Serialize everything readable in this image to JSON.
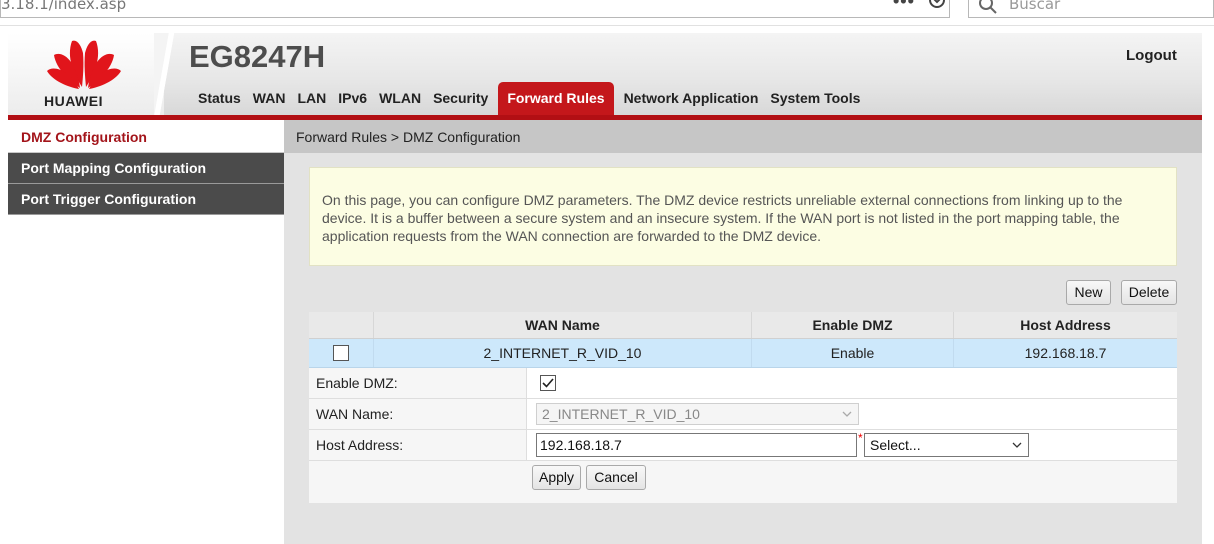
{
  "browser": {
    "url": "3.18.1/index.asp",
    "search_placeholder": "Buscar"
  },
  "header": {
    "brand": "HUAWEI",
    "model": "EG8247H",
    "logout": "Logout",
    "brand_color": "#c4171b"
  },
  "nav": {
    "tabs": [
      {
        "label": "Status"
      },
      {
        "label": "WAN"
      },
      {
        "label": "LAN"
      },
      {
        "label": "IPv6"
      },
      {
        "label": "WLAN"
      },
      {
        "label": "Security"
      },
      {
        "label": "Forward Rules",
        "active": true
      },
      {
        "label": "Network Application"
      },
      {
        "label": "System Tools"
      }
    ]
  },
  "sidebar": {
    "items": [
      {
        "label": "DMZ Configuration",
        "active": true
      },
      {
        "label": "Port Mapping Configuration"
      },
      {
        "label": "Port Trigger Configuration"
      }
    ]
  },
  "main": {
    "breadcrumb": "Forward Rules > DMZ Configuration",
    "info": "On this page, you can configure DMZ parameters. The DMZ device restricts unreliable external connections from linking up to the device. It is a buffer between a secure system and an insecure system. If the WAN port is not listed in the port mapping table, the application requests from the WAN connection are forwarded to the DMZ device.",
    "buttons": {
      "new": "New",
      "delete": "Delete",
      "apply": "Apply",
      "cancel": "Cancel"
    },
    "table": {
      "headers": [
        "WAN Name",
        "Enable DMZ",
        "Host Address"
      ],
      "rows": [
        {
          "wan_name": "2_INTERNET_R_VID_10",
          "enable_dmz": "Enable",
          "host_address": "192.168.18.7",
          "checked": false
        }
      ]
    },
    "form": {
      "enable_label": "Enable DMZ:",
      "enable_checked": true,
      "wan_label": "WAN Name:",
      "wan_value": "2_INTERNET_R_VID_10",
      "host_label": "Host Address:",
      "host_value": "192.168.18.7",
      "required_mark": "*",
      "select_value": "Select..."
    }
  }
}
